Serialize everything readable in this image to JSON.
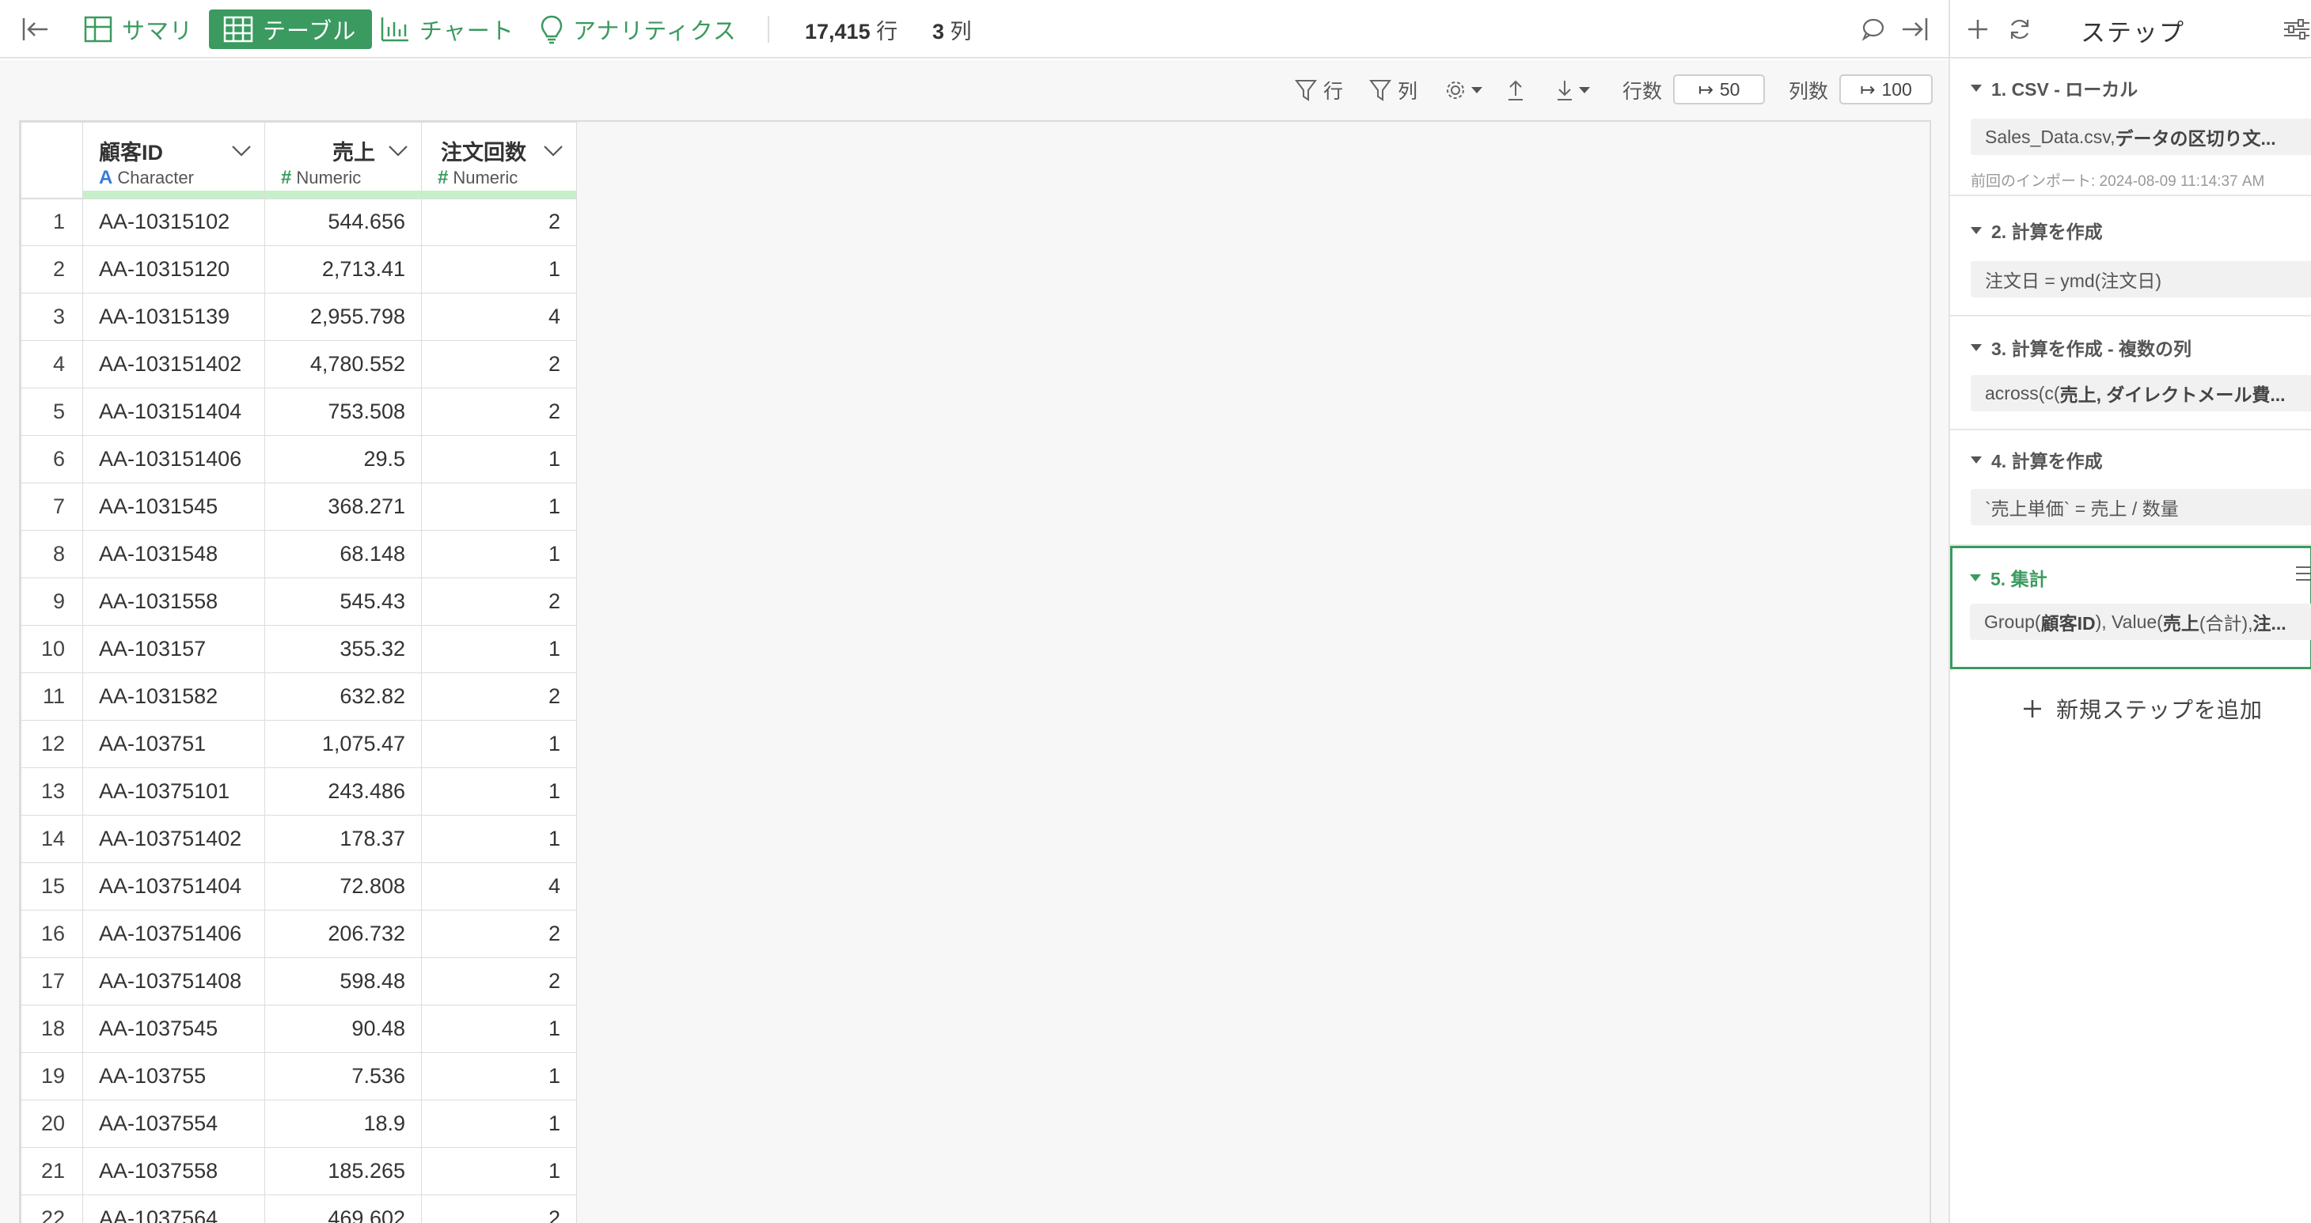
{
  "toolbar": {
    "summary_label": "サマリ",
    "table_label": "テーブル",
    "chart_label": "チャート",
    "analytics_label": "アナリティクス",
    "row_count": "17,415",
    "row_unit": "行",
    "col_count": "3",
    "col_unit": "列",
    "accent_color": "#3a9a5f"
  },
  "subbar": {
    "row_filter_label": "行",
    "col_filter_label": "列",
    "rows_label": "行数",
    "rows_value": "50",
    "cols_label": "列数",
    "cols_value": "100"
  },
  "table": {
    "columns": [
      {
        "name": "顧客ID",
        "type": "Character",
        "type_symbol": "A"
      },
      {
        "name": "売上",
        "type": "Numeric",
        "type_symbol": "#"
      },
      {
        "name": "注文回数",
        "type": "Numeric",
        "type_symbol": "#"
      }
    ],
    "rows": [
      [
        "1",
        "AA-10315102",
        "544.656",
        "2"
      ],
      [
        "2",
        "AA-10315120",
        "2,713.41",
        "1"
      ],
      [
        "3",
        "AA-10315139",
        "2,955.798",
        "4"
      ],
      [
        "4",
        "AA-103151402",
        "4,780.552",
        "2"
      ],
      [
        "5",
        "AA-103151404",
        "753.508",
        "2"
      ],
      [
        "6",
        "AA-103151406",
        "29.5",
        "1"
      ],
      [
        "7",
        "AA-1031545",
        "368.271",
        "1"
      ],
      [
        "8",
        "AA-1031548",
        "68.148",
        "1"
      ],
      [
        "9",
        "AA-1031558",
        "545.43",
        "2"
      ],
      [
        "10",
        "AA-103157",
        "355.32",
        "1"
      ],
      [
        "11",
        "AA-1031582",
        "632.82",
        "2"
      ],
      [
        "12",
        "AA-103751",
        "1,075.47",
        "1"
      ],
      [
        "13",
        "AA-10375101",
        "243.486",
        "1"
      ],
      [
        "14",
        "AA-103751402",
        "178.37",
        "1"
      ],
      [
        "15",
        "AA-103751404",
        "72.808",
        "4"
      ],
      [
        "16",
        "AA-103751406",
        "206.732",
        "2"
      ],
      [
        "17",
        "AA-103751408",
        "598.48",
        "2"
      ],
      [
        "18",
        "AA-1037545",
        "90.48",
        "1"
      ],
      [
        "19",
        "AA-103755",
        "7.536",
        "1"
      ],
      [
        "20",
        "AA-1037554",
        "18.9",
        "1"
      ],
      [
        "21",
        "AA-1037558",
        "185.265",
        "1"
      ],
      [
        "22",
        "AA-1037564",
        "469.602",
        "2"
      ]
    ]
  },
  "steps_panel": {
    "title": "ステップ",
    "steps": [
      {
        "title": "1. CSV - ローカル",
        "body_plain": "Sales_Data.csv, ",
        "body_bold": "データの区切り文...",
        "note": "前回のインポート: 2024-08-09 11:14:37 AM"
      },
      {
        "title": "2. 計算を作成",
        "body_plain": "注文日 = ymd(注文日)"
      },
      {
        "title": "3. 計算を作成 - 複数の列",
        "body_plain": "across(c(",
        "body_bold": "売上, ダイレクトメール費..."
      },
      {
        "title": "4. 計算を作成",
        "body_plain": "`売上単価` = 売上 / 数量"
      },
      {
        "title": "5. 集計",
        "body_p1": "Group(",
        "body_b1": "顧客ID",
        "body_p2": "), Value(",
        "body_b2": "売上",
        "body_p3": " (合計),",
        "body_b3": "注..."
      }
    ],
    "add_step_label": "新規ステップを追加"
  }
}
